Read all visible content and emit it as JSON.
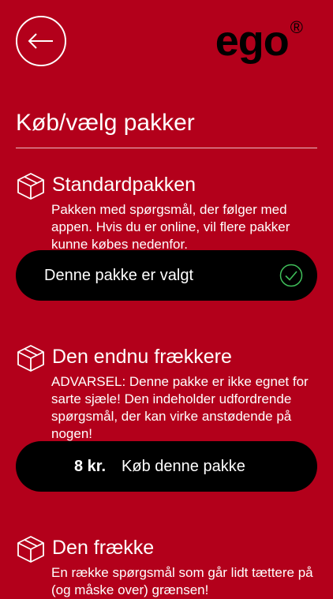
{
  "header": {
    "back_icon": "arrow-left-icon",
    "logo_text": "ego",
    "logo_reg": "®"
  },
  "page": {
    "title": "Køb/vælg pakker"
  },
  "colors": {
    "background": "#b3001b",
    "button_bg": "#000000",
    "check": "#3fbf5a",
    "text": "#ffffff"
  },
  "packages": [
    {
      "icon": "package-box-icon",
      "title": "Standardpakken",
      "description": "Pakken med spørgsmål, der følger med appen. Hvis du er online, vil flere pakker kunne købes nedenfor.",
      "status_label": "Denne pakke er valgt",
      "status_icon": "checkmark-circle-icon"
    },
    {
      "icon": "package-box-icon",
      "title": "Den endnu frækkere",
      "description": "ADVARSEL: Denne pakke er ikke egnet for sarte sjæle! Den indeholder udfordrende spørgsmål, der kan virke anstødende på nogen!",
      "price": "8 kr.",
      "buy_label": "Køb denne pakke"
    },
    {
      "icon": "package-box-icon",
      "title": "Den frække",
      "description": "En række spørgsmål som går lidt tættere på (og måske over) grænsen!"
    }
  ]
}
